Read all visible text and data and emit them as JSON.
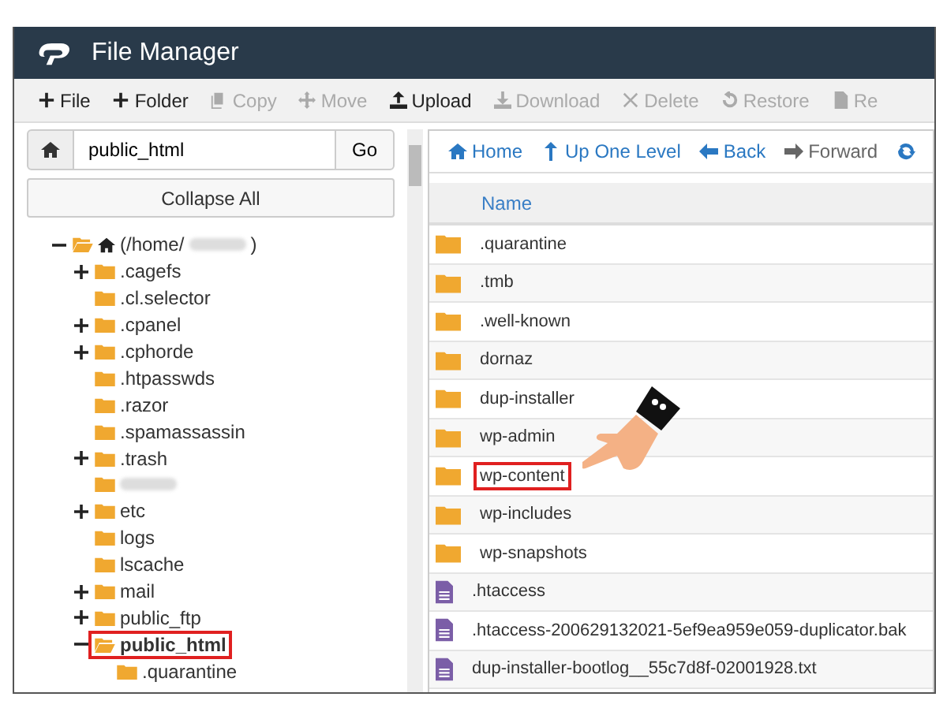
{
  "window": {
    "title": "File Manager"
  },
  "toolbar": [
    {
      "label": "File",
      "disabled": false
    },
    {
      "label": "Folder",
      "disabled": false
    },
    {
      "label": "Copy",
      "disabled": true
    },
    {
      "label": "Move",
      "disabled": true
    },
    {
      "label": "Upload",
      "disabled": false
    },
    {
      "label": "Download",
      "disabled": true
    },
    {
      "label": "Delete",
      "disabled": true
    },
    {
      "label": "Restore",
      "disabled": true
    },
    {
      "label": "Re",
      "disabled": true
    }
  ],
  "path_bar": {
    "value": "public_html",
    "button": "Go"
  },
  "collapse_button": "Collapse All",
  "tree": {
    "label": "(/home/",
    "label_end": ")",
    "redacted": true,
    "expanded": true,
    "children": [
      {
        "label": ".cagefs",
        "expanded": false
      },
      {
        "label": ".cl.selector"
      },
      {
        "label": ".cpanel",
        "expanded": false
      },
      {
        "label": ".cphorde",
        "expanded": false
      },
      {
        "label": ".htpasswds"
      },
      {
        "label": ".razor"
      },
      {
        "label": ".spamassassin"
      },
      {
        "label": ".trash",
        "expanded": false
      },
      {
        "redacted": true
      },
      {
        "label": "etc",
        "expanded": false
      },
      {
        "label": "logs"
      },
      {
        "label": "lscache"
      },
      {
        "label": "mail",
        "expanded": false
      },
      {
        "label": "public_ftp",
        "expanded": false
      },
      {
        "label": "public_html",
        "expanded": true,
        "highlighted": true,
        "children": [
          {
            "label": ".quarantine"
          }
        ]
      }
    ]
  },
  "nav": [
    {
      "label": "Home",
      "disabled": false
    },
    {
      "label": "Up One Level",
      "disabled": false
    },
    {
      "label": "Back",
      "disabled": false
    },
    {
      "label": "Forward",
      "disabled": true
    },
    {
      "disabled": false
    }
  ],
  "table": {
    "columns": [
      "Name"
    ],
    "rows": [
      {
        "name": ".quarantine",
        "kind": "folder",
        "highlighted": false
      },
      {
        "name": ".tmb",
        "kind": "folder",
        "highlighted": false
      },
      {
        "name": ".well-known",
        "kind": "folder",
        "highlighted": false
      },
      {
        "name": "dornaz",
        "kind": "folder",
        "highlighted": false
      },
      {
        "name": "dup-installer",
        "kind": "folder",
        "highlighted": false
      },
      {
        "name": "wp-admin",
        "kind": "folder",
        "highlighted": false
      },
      {
        "name": "wp-content",
        "kind": "folder",
        "highlighted": true
      },
      {
        "name": "wp-includes",
        "kind": "folder",
        "highlighted": false
      },
      {
        "name": "wp-snapshots",
        "kind": "folder",
        "highlighted": false
      },
      {
        "name": ".htaccess",
        "kind": "file",
        "highlighted": false
      },
      {
        "name": ".htaccess-200629132021-5ef9ea959e059-duplicator.bak",
        "kind": "file",
        "highlighted": false
      },
      {
        "name": "dup-installer-bootlog__55c7d8f-02001928.txt",
        "kind": "file",
        "highlighted": false
      }
    ]
  }
}
